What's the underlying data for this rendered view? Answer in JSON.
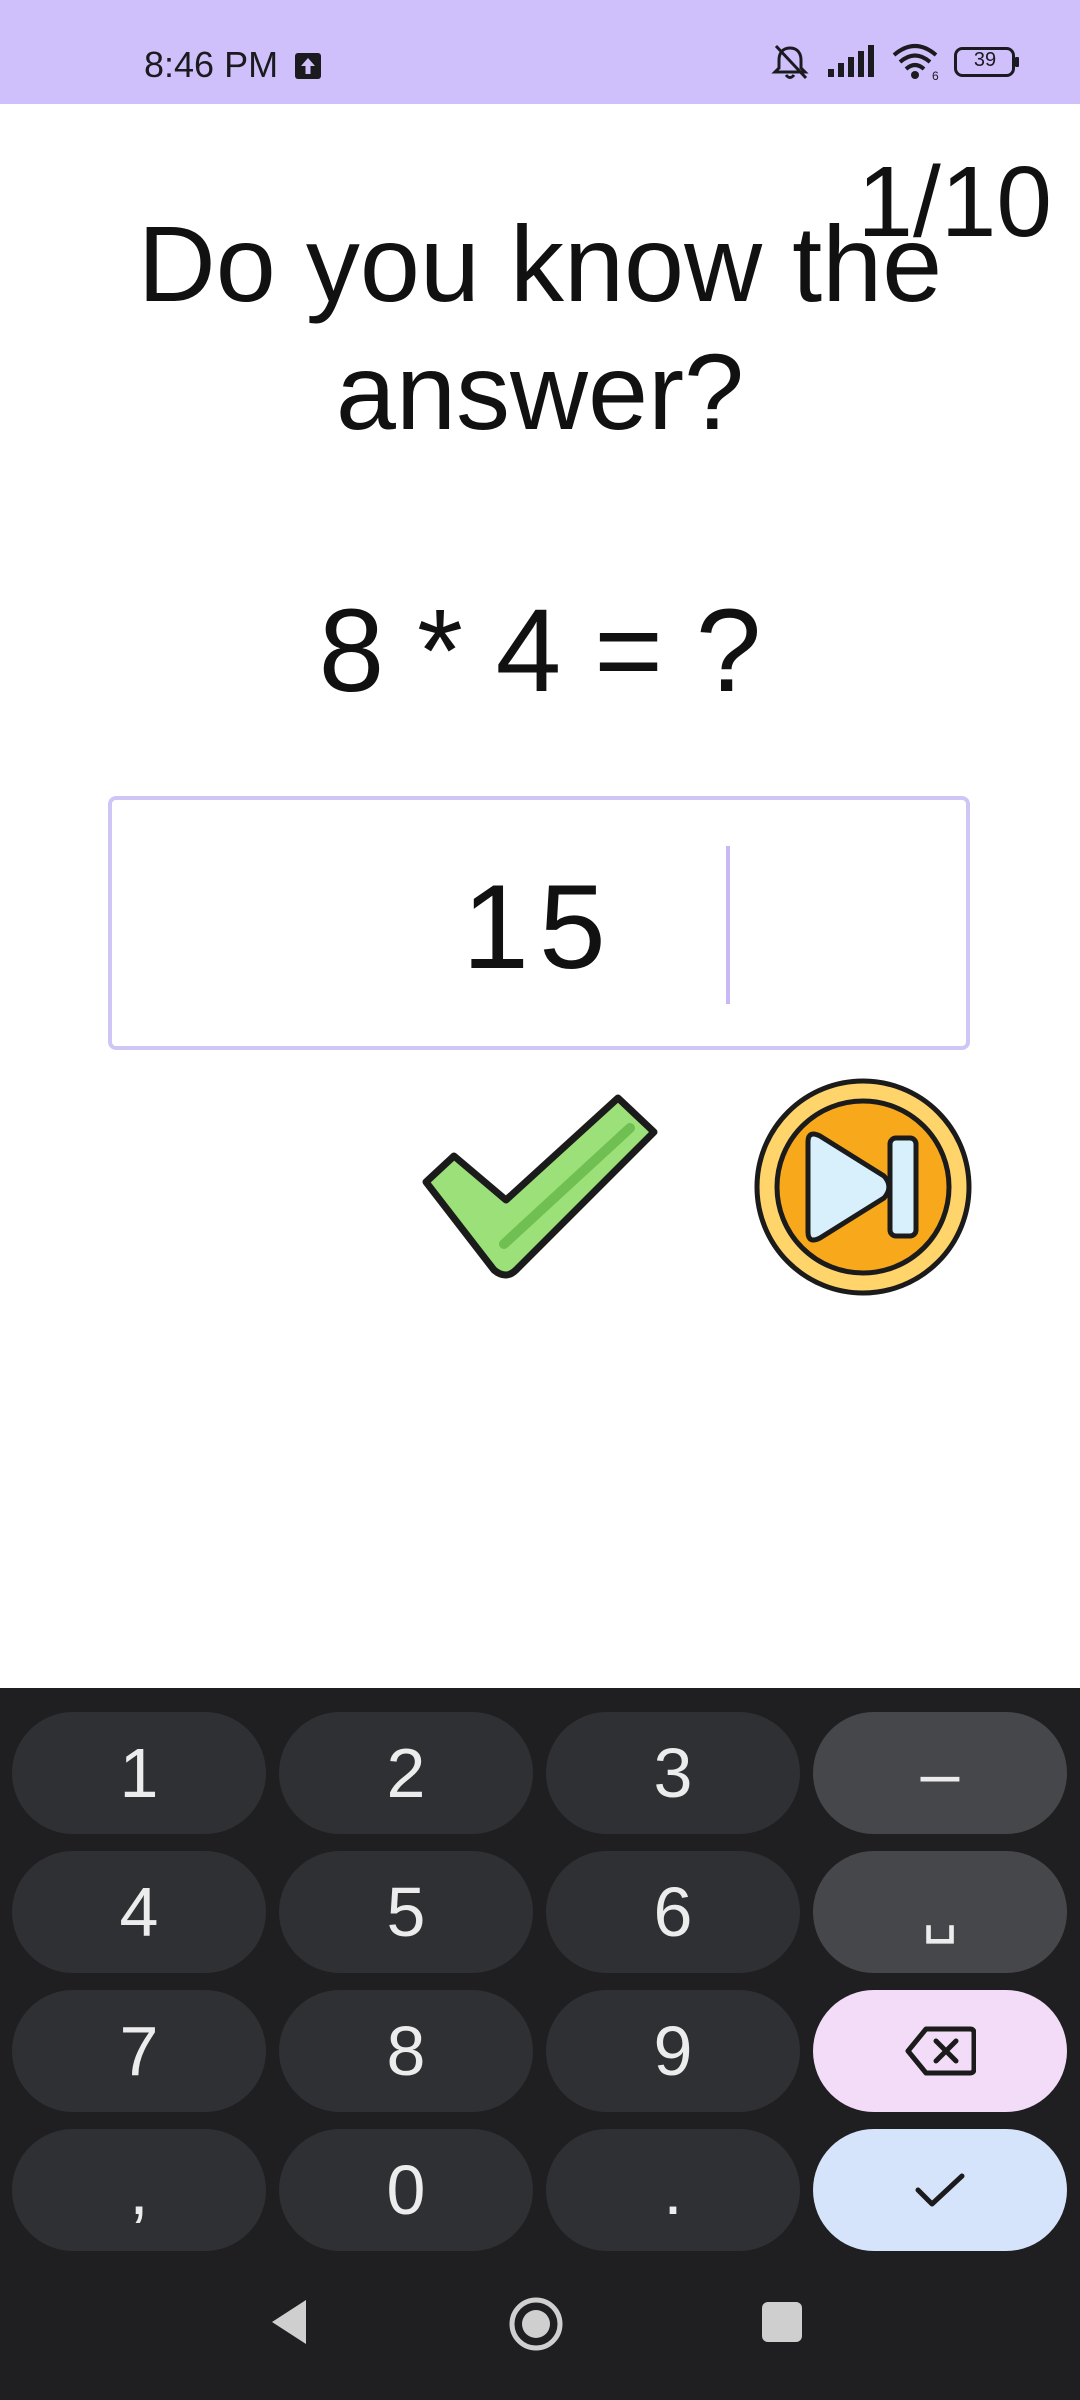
{
  "status_bar": {
    "time": "8:46 PM",
    "battery": "39",
    "icons": [
      "upload-icon",
      "muted-bell-icon",
      "signal-icon",
      "wifi-icon",
      "battery-icon"
    ],
    "background": "#cfc0fb"
  },
  "quiz": {
    "progress": "1/10",
    "title": "Do you know the answer?",
    "question": "8 * 4 = ?",
    "answer_value": "15",
    "check_icon": "checkmark-icon",
    "skip_icon": "skip-next-icon"
  },
  "keyboard": {
    "keys": [
      {
        "label": "1"
      },
      {
        "label": "2"
      },
      {
        "label": "3"
      },
      {
        "label": "–"
      },
      {
        "label": "4"
      },
      {
        "label": "5"
      },
      {
        "label": "6"
      },
      {
        "label": "␣"
      },
      {
        "label": "7"
      },
      {
        "label": "8"
      },
      {
        "label": "9"
      },
      {
        "label": "backspace",
        "icon": "backspace-icon"
      },
      {
        "label": ","
      },
      {
        "label": "0"
      },
      {
        "label": "."
      },
      {
        "label": "done",
        "icon": "checkmark-icon"
      }
    ],
    "colors": {
      "key": "#2f3034",
      "func": "#46474b",
      "delete": "#f2dcf7",
      "enter": "#d5e3fb",
      "background": "#1f1f21"
    }
  },
  "nav_bar": {
    "icons": [
      "back-icon",
      "home-icon",
      "recents-icon"
    ]
  }
}
